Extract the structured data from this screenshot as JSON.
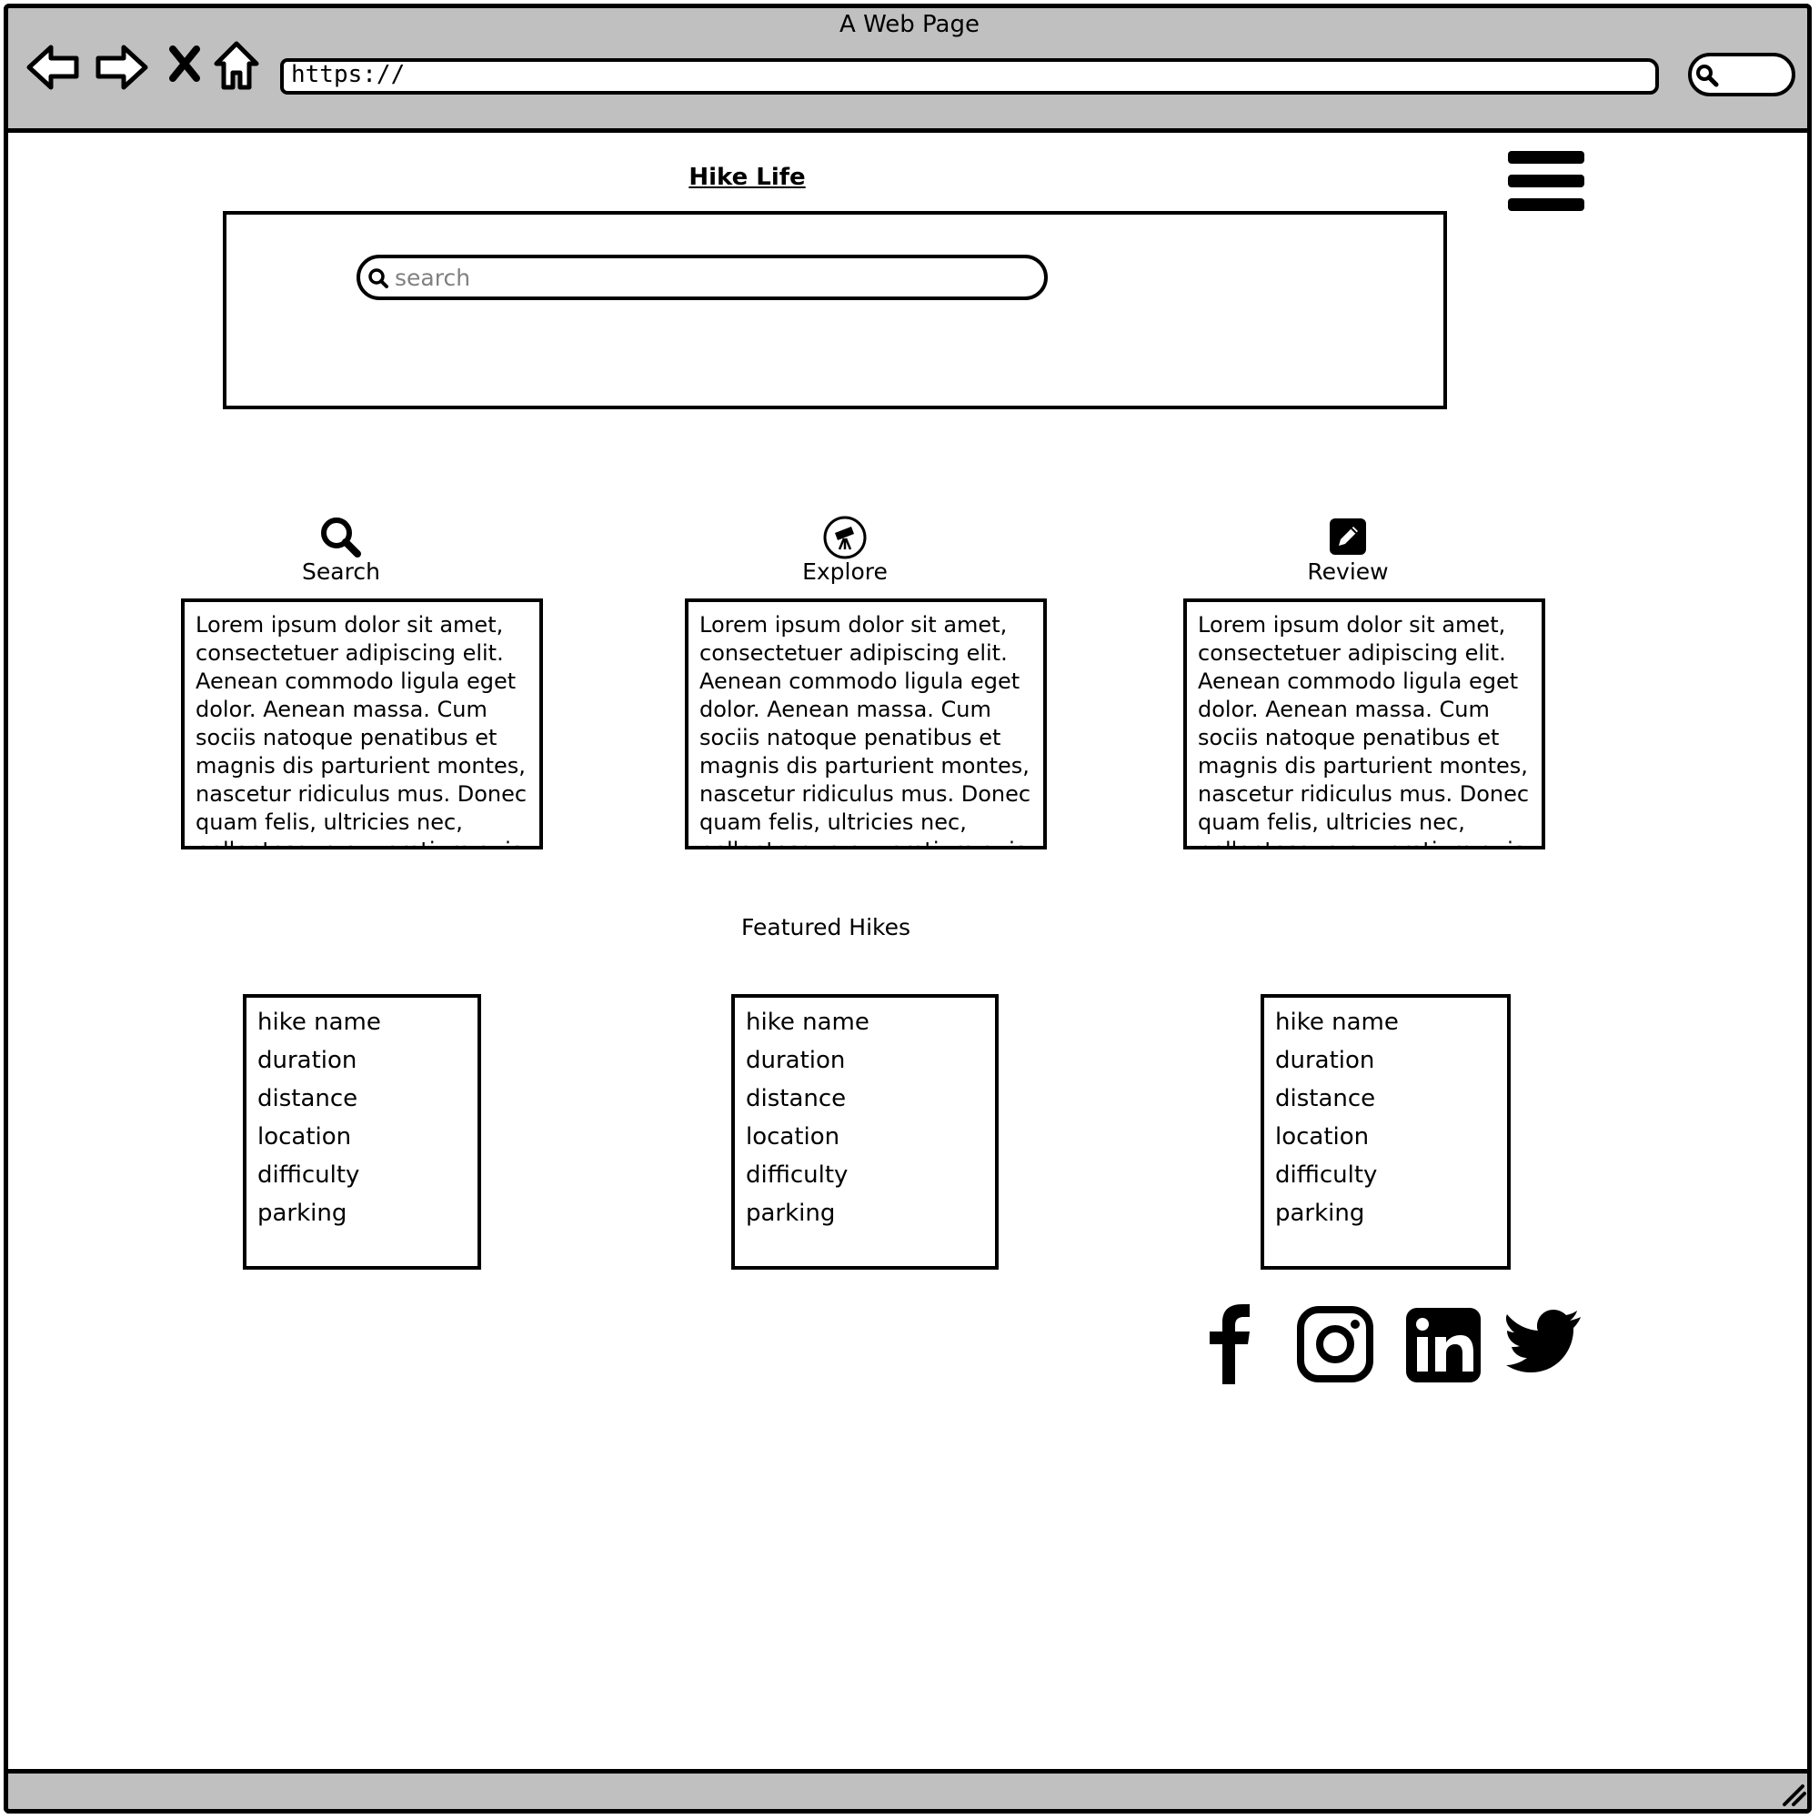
{
  "browser": {
    "window_title": "A Web Page",
    "url": "https://",
    "nav_icons": [
      "back-arrow-icon",
      "forward-arrow-icon",
      "stop-icon",
      "home-icon"
    ],
    "search_icon": "search-icon",
    "resize_icon": "resize-grip-icon"
  },
  "site": {
    "title": "Hike Life",
    "menu_icon": "hamburger-menu-icon",
    "search": {
      "placeholder": "search",
      "value": ""
    }
  },
  "features": [
    {
      "label": "Search",
      "icon": "magnifier-icon",
      "text": "Lorem ipsum dolor sit amet, consectetuer adipiscing elit. Aenean commodo ligula eget dolor. Aenean massa. Cum sociis natoque penatibus et magnis dis parturient montes, nascetur ridiculus mus. Donec quam felis, ultricies nec, pellentesque eu, pretium quis"
    },
    {
      "label": "Explore",
      "icon": "telescope-icon",
      "text": "Lorem ipsum dolor sit amet, consectetuer adipiscing elit. Aenean commodo ligula eget dolor. Aenean massa. Cum sociis natoque penatibus et magnis dis parturient montes, nascetur ridiculus mus. Donec quam felis, ultricies nec, pellentesque eu, pretium quis"
    },
    {
      "label": "Review",
      "icon": "pencil-square-icon",
      "text": "Lorem ipsum dolor sit amet, consectetuer adipiscing elit. Aenean commodo ligula eget dolor. Aenean massa. Cum sociis natoque penatibus et magnis dis parturient montes, nascetur ridiculus mus. Donec quam felis, ultricies nec, pellentesque eu, pretium quis"
    }
  ],
  "featured": {
    "heading": "Featured Hikes",
    "cards": [
      [
        "hike name",
        "duration",
        "distance",
        "location",
        "difficulty",
        "parking"
      ],
      [
        "hike name",
        "duration",
        "distance",
        "location",
        "difficulty",
        "parking"
      ],
      [
        "hike name",
        "duration",
        "distance",
        "location",
        "difficulty",
        "parking"
      ]
    ]
  },
  "social": [
    "facebook-icon",
    "instagram-icon",
    "linkedin-icon",
    "twitter-icon"
  ]
}
